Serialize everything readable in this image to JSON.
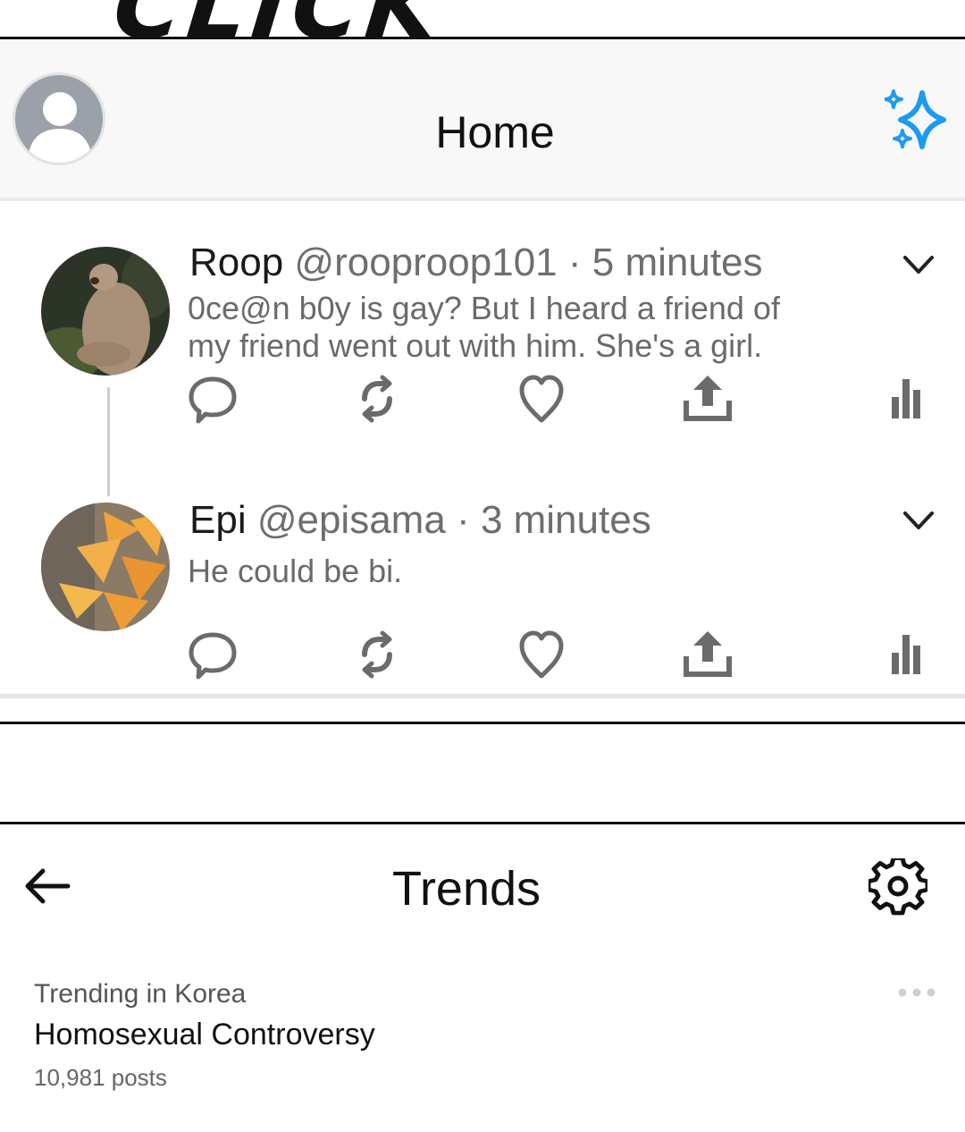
{
  "overlay": {
    "caption": "CLICK"
  },
  "header": {
    "title": "Home",
    "avatar_icon": "default-profile-icon",
    "sparkle_icon": "sparkle-icon",
    "accent_color": "#1d9bf0"
  },
  "tweets": [
    {
      "name": "Roop",
      "handle": "@rooproop101",
      "separator": "·",
      "time": "5 minutes",
      "text_lines": [
        "0ce@n b0y is gay? But I heard a friend of",
        "my friend went out with him. She's a girl."
      ],
      "avatar": "marmot-photo"
    },
    {
      "name": "Epi",
      "handle": "@episama",
      "separator": "·",
      "time": "3 minutes",
      "text_lines": [
        "He could be bi."
      ],
      "avatar": "nachos-photo"
    }
  ],
  "actions": [
    "reply-icon",
    "retweet-icon",
    "like-icon",
    "share-icon",
    "analytics-icon"
  ],
  "trends": {
    "title": "Trends",
    "back_icon": "back-arrow-icon",
    "settings_icon": "gear-icon",
    "items": [
      {
        "context": "Trending in Korea",
        "name": "Homosexual Controversy",
        "count": "10,981 posts"
      }
    ]
  }
}
